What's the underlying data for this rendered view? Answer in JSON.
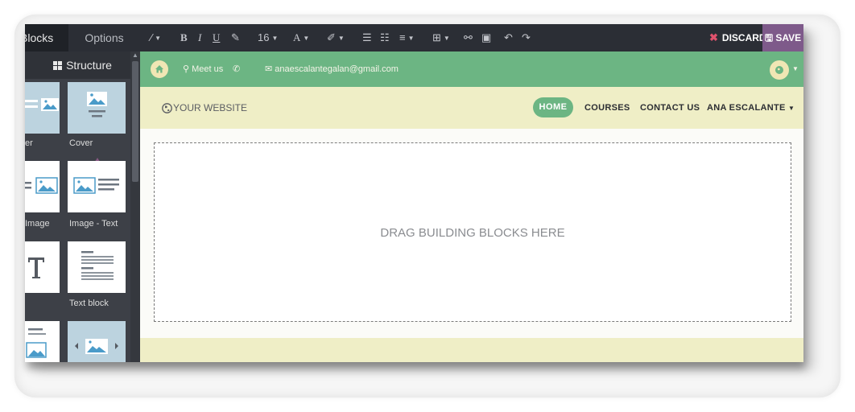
{
  "panel": {
    "tab_blocks": "Blocks",
    "tab_options": "Options",
    "structure_title": "Structure",
    "blocks": [
      {
        "label": "Cover",
        "style": "blue",
        "icon": "cover-icon"
      },
      {
        "label": "Cover",
        "style": "blue",
        "icon": "cover-icon"
      },
      {
        "label": "Image",
        "style": "white",
        "icon": "image-text-icon"
      },
      {
        "label": "Image - Text",
        "style": "white",
        "icon": "image-text-icon"
      },
      {
        "label": "",
        "style": "white",
        "icon": "text-t-icon"
      },
      {
        "label": "Text block",
        "style": "white",
        "icon": "text-lines-icon"
      },
      {
        "label": "",
        "style": "white",
        "icon": "text-image-icon"
      },
      {
        "label": "",
        "style": "blue",
        "icon": "slider-icon"
      }
    ],
    "first_label_fragment": "er"
  },
  "toolbar": {
    "font_size": "16",
    "discard_label": "DISCARD",
    "save_label": "SAVE"
  },
  "site": {
    "topbar": {
      "meet_label": "Meet us",
      "email": "anaescalantegalan@gmail.com"
    },
    "brand": "YOUR WEBSITE",
    "nav": {
      "home": "HOME",
      "courses": "COURSES",
      "contact": "CONTACT US",
      "user": "ANA ESCALANTE"
    },
    "dropzone_text": "DRAG BUILDING BLOCKS HERE"
  },
  "colors": {
    "green": "#6cb583",
    "cream": "#efeec6",
    "save_purple": "#7e5a8a",
    "discard_red": "#e0526d",
    "dark": "#2b2e35"
  }
}
